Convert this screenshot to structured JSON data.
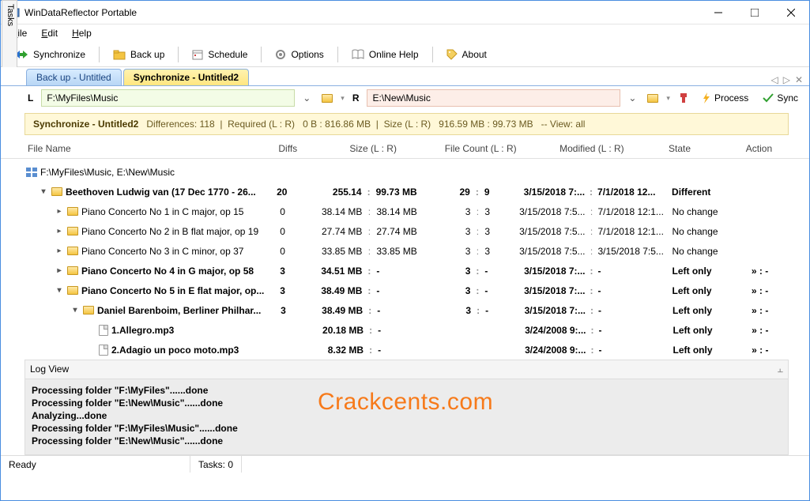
{
  "window": {
    "title": "WinDataReflector Portable"
  },
  "menu": {
    "file": "File",
    "edit": "Edit",
    "help": "Help"
  },
  "toolbar": {
    "sync": "Synchronize",
    "backup": "Back up",
    "schedule": "Schedule",
    "options": "Options",
    "onlinehelp": "Online Help",
    "about": "About"
  },
  "sidebar_tab": "Tasks",
  "tabs": {
    "inactive": "Back up - Untitled",
    "active": "Synchronize - Untitled2"
  },
  "paths": {
    "left_label": "L",
    "left_value": "F:\\MyFiles\\Music",
    "right_label": "R",
    "right_value": "E:\\New\\Music",
    "process": "Process",
    "sync": "Sync"
  },
  "infobar": {
    "name": "Synchronize - Untitled2",
    "diffs_label": "Differences:",
    "diffs": "118",
    "required_label": "Required (L : R)",
    "required": "0 B : 816.86 MB",
    "size_label": "Size (L : R)",
    "size": "916.59 MB : 99.73 MB",
    "view_label": "-- View:",
    "view": "all"
  },
  "headers": {
    "filename": "File Name",
    "diffs": "Diffs",
    "size": "Size (L : R)",
    "count": "File Count (L : R)",
    "modified": "Modified (L : R)",
    "state": "State",
    "action": "Action"
  },
  "root": "F:\\MyFiles\\Music, E:\\New\\Music",
  "rows": [
    {
      "indent": 1,
      "exp": "▾",
      "icon": "folder",
      "bold": true,
      "name": "Beethoven Ludwig van (17 Dec 1770 - 26...",
      "diffs": "20",
      "sl": "255.14",
      "sr": "99.73 MB",
      "cl": "29",
      "cr": "9",
      "ml": "3/15/2018 7:...",
      "mr": "7/1/2018 12...",
      "state": "Different",
      "action": ""
    },
    {
      "indent": 2,
      "exp": "▸",
      "icon": "folder",
      "bold": false,
      "name": "Piano Concerto No 1 in C major, op 15",
      "diffs": "0",
      "sl": "38.14 MB",
      "sr": "38.14 MB",
      "cl": "3",
      "cr": "3",
      "ml": "3/15/2018 7:5...",
      "mr": "7/1/2018 12:1...",
      "state": "No change",
      "action": ""
    },
    {
      "indent": 2,
      "exp": "▸",
      "icon": "folder",
      "bold": false,
      "name": "Piano Concerto No 2 in B flat major, op 19",
      "diffs": "0",
      "sl": "27.74 MB",
      "sr": "27.74 MB",
      "cl": "3",
      "cr": "3",
      "ml": "3/15/2018 7:5...",
      "mr": "7/1/2018 12:1...",
      "state": "No change",
      "action": ""
    },
    {
      "indent": 2,
      "exp": "▸",
      "icon": "folder",
      "bold": false,
      "name": "Piano Concerto No 3 in C minor, op 37",
      "diffs": "0",
      "sl": "33.85 MB",
      "sr": "33.85 MB",
      "cl": "3",
      "cr": "3",
      "ml": "3/15/2018 7:5...",
      "mr": "3/15/2018 7:5...",
      "state": "No change",
      "action": ""
    },
    {
      "indent": 2,
      "exp": "▸",
      "icon": "folder",
      "bold": true,
      "name": "Piano Concerto No 4 in G major, op 58",
      "diffs": "3",
      "sl": "34.51 MB",
      "sr": "-",
      "cl": "3",
      "cr": "-",
      "ml": "3/15/2018 7:...",
      "mr": "-",
      "state": "Left only",
      "action": "»  :  -"
    },
    {
      "indent": 2,
      "exp": "▾",
      "icon": "folder",
      "bold": true,
      "name": "Piano Concerto No 5 in E flat major, op...",
      "diffs": "3",
      "sl": "38.49 MB",
      "sr": "-",
      "cl": "3",
      "cr": "-",
      "ml": "3/15/2018 7:...",
      "mr": "-",
      "state": "Left only",
      "action": "»  :  -"
    },
    {
      "indent": 3,
      "exp": "▾",
      "icon": "folder",
      "bold": true,
      "name": "Daniel Barenboim, Berliner Philhar...",
      "diffs": "3",
      "sl": "38.49 MB",
      "sr": "-",
      "cl": "3",
      "cr": "-",
      "ml": "3/15/2018 7:...",
      "mr": "-",
      "state": "Left only",
      "action": "»  :  -"
    },
    {
      "indent": 4,
      "exp": "",
      "icon": "file",
      "bold": true,
      "name": "1.Allegro.mp3",
      "diffs": "",
      "sl": "20.18 MB",
      "sr": "-",
      "cl": "",
      "cr": "",
      "ml": "3/24/2008 9:...",
      "mr": "-",
      "state": "Left only",
      "action": "»  :  -"
    },
    {
      "indent": 4,
      "exp": "",
      "icon": "file",
      "bold": true,
      "name": "2.Adagio un poco moto.mp3",
      "diffs": "",
      "sl": "8.32 MB",
      "sr": "-",
      "cl": "",
      "cr": "",
      "ml": "3/24/2008 9:...",
      "mr": "-",
      "state": "Left only",
      "action": "»  :  -"
    }
  ],
  "logview": {
    "title": "Log View",
    "lines": [
      "Processing folder \"F:\\MyFiles\"......done",
      "Processing folder \"E:\\New\\Music\"......done",
      "Analyzing...done",
      "Processing folder \"F:\\MyFiles\\Music\"......done",
      "Processing folder \"E:\\New\\Music\"......done"
    ]
  },
  "watermark": "Crackcents.com",
  "status": {
    "ready": "Ready",
    "tasks": "Tasks: 0"
  }
}
